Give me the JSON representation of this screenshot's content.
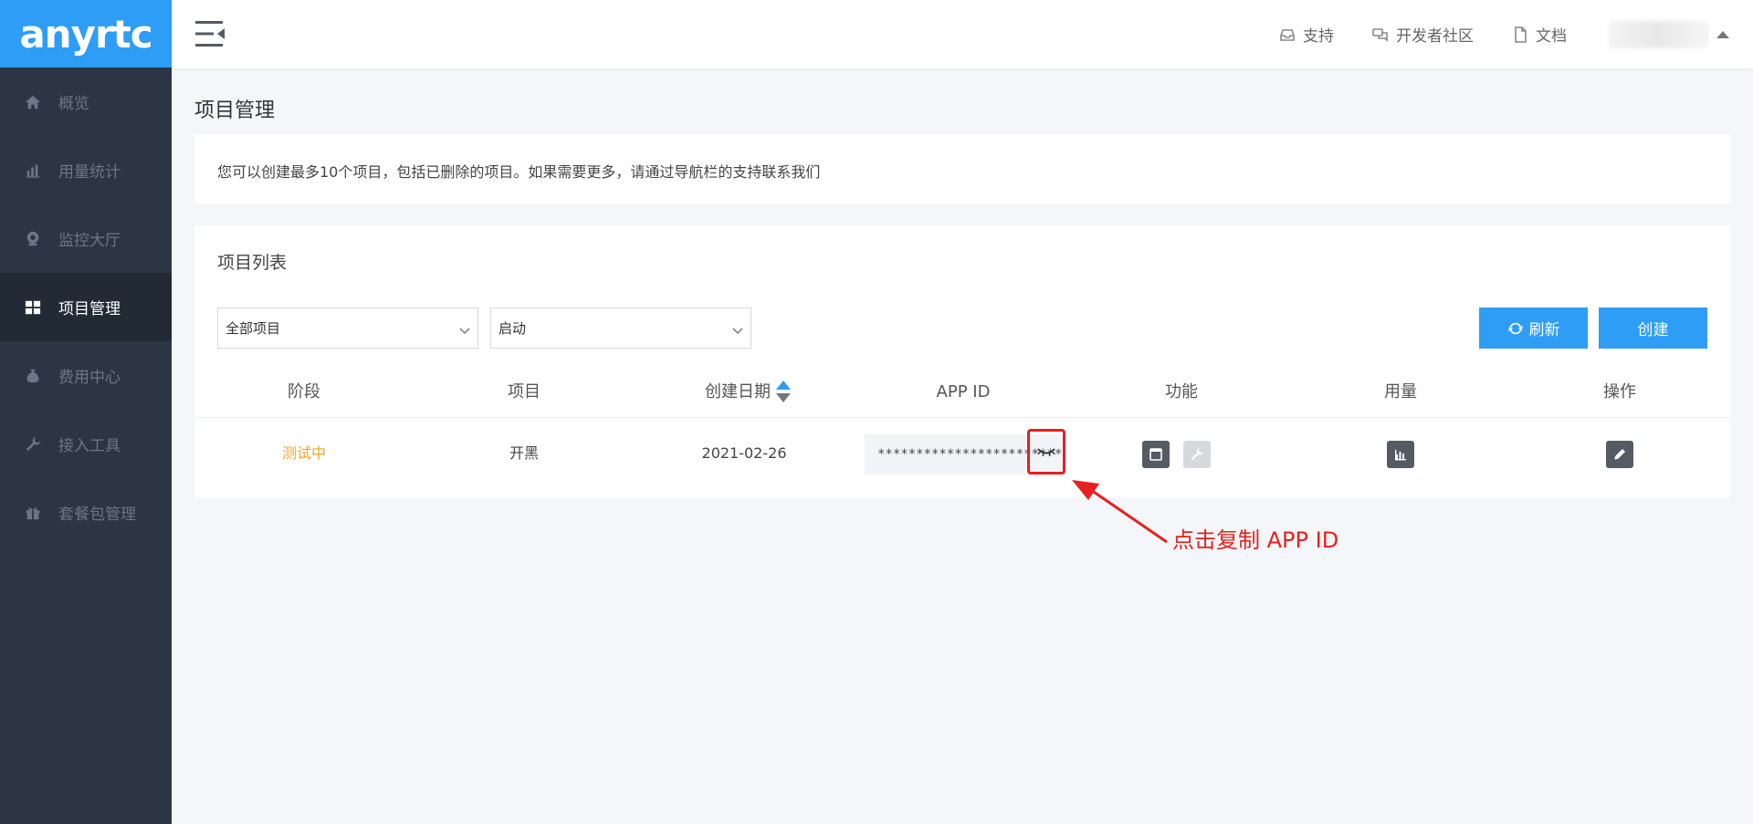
{
  "brand": {
    "logo_text": "anyrtc",
    "accent": "#2e9df5"
  },
  "sidebar": {
    "items": [
      {
        "label": "概览",
        "icon": "home-icon",
        "active": false
      },
      {
        "label": "用量统计",
        "icon": "bar-chart-icon",
        "active": false
      },
      {
        "label": "监控大厅",
        "icon": "webcam-icon",
        "active": false
      },
      {
        "label": "项目管理",
        "icon": "grid-icon",
        "active": true
      },
      {
        "label": "费用中心",
        "icon": "money-bag-icon",
        "active": false
      },
      {
        "label": "接入工具",
        "icon": "wrench-icon",
        "active": false
      },
      {
        "label": "套餐包管理",
        "icon": "gift-icon",
        "active": false
      }
    ]
  },
  "header": {
    "links": [
      {
        "label": "支持",
        "icon": "support-icon"
      },
      {
        "label": "开发者社区",
        "icon": "chat-icon"
      },
      {
        "label": "文档",
        "icon": "document-icon"
      }
    ]
  },
  "main": {
    "page_title": "项目管理",
    "notice": "您可以创建最多10个项目，包括已删除的项目。如果需要更多，请通过导航栏的支持联系我们",
    "card_title": "项目列表",
    "filter_scope": "全部项目",
    "filter_status": "启动",
    "refresh_label": "刷新",
    "create_label": "创建",
    "columns": [
      "阶段",
      "项目",
      "创建日期",
      "APP ID",
      "功能",
      "用量",
      "操作"
    ],
    "rows": [
      {
        "stage": "测试中",
        "project": "开黑",
        "created": "2021-02-26",
        "app_id": "*************************"
      }
    ]
  },
  "annotation": {
    "text": "点击复制 APP ID",
    "color": "#e62020"
  }
}
